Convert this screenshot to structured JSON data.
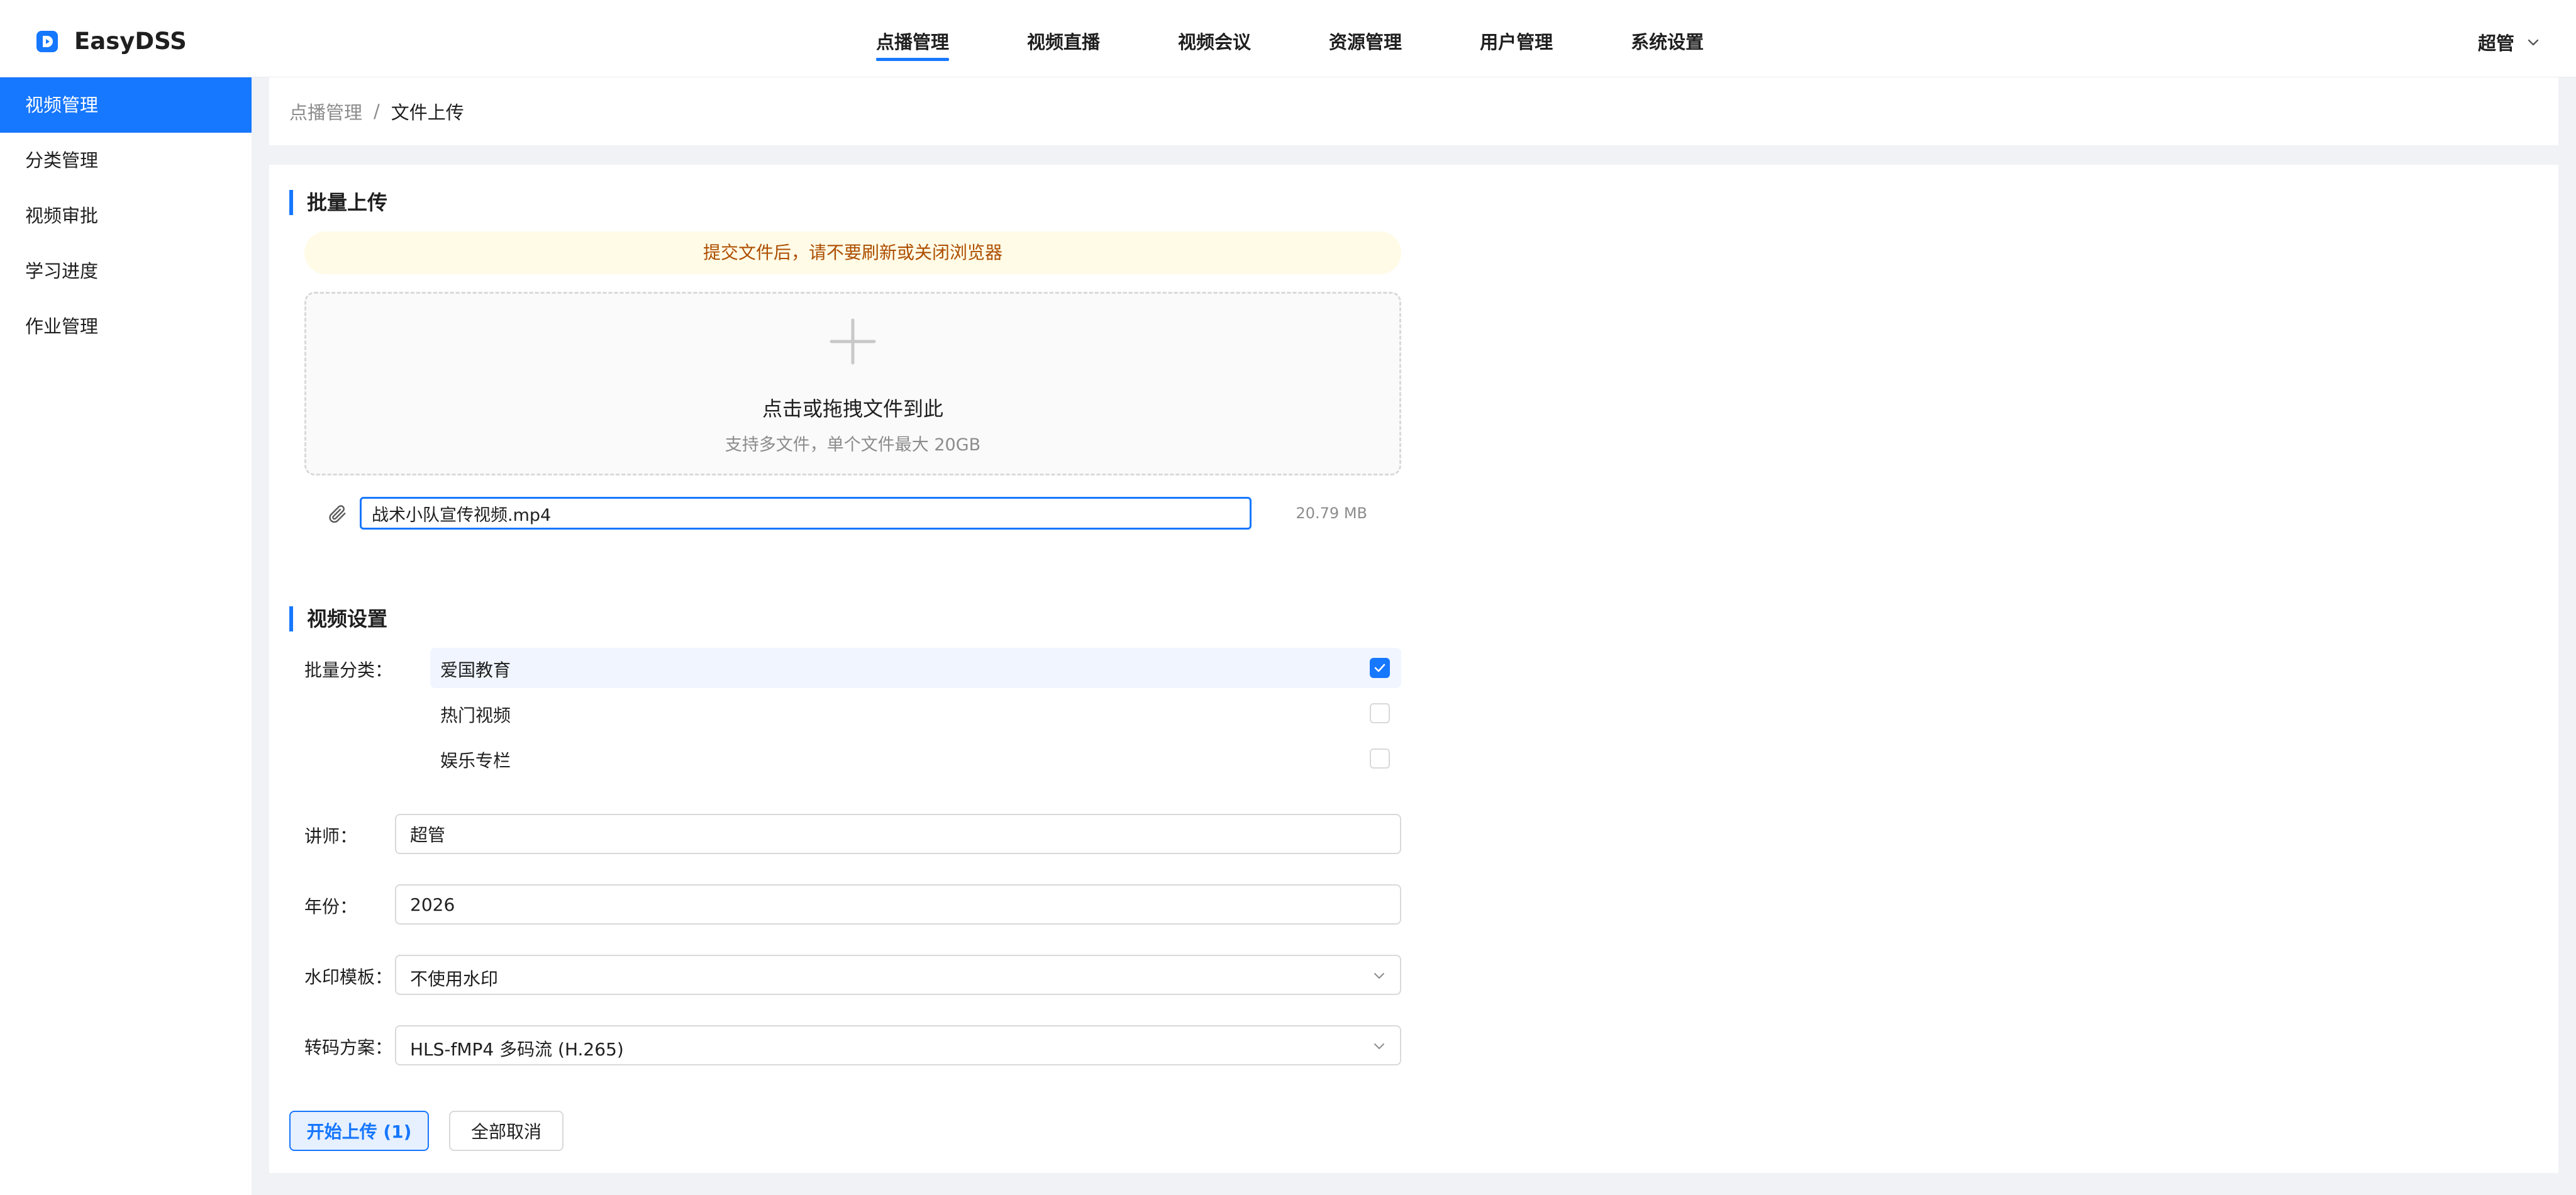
{
  "app": {
    "name": "EasyDSS"
  },
  "nav": [
    {
      "label": "点播管理",
      "active": true
    },
    {
      "label": "视频直播"
    },
    {
      "label": "视频会议"
    },
    {
      "label": "资源管理"
    },
    {
      "label": "用户管理"
    },
    {
      "label": "系统设置"
    }
  ],
  "user": {
    "name": "超管"
  },
  "sidebar": {
    "items": [
      {
        "label": "视频管理",
        "active": true
      },
      {
        "label": "分类管理"
      },
      {
        "label": "视频审批"
      },
      {
        "label": "学习进度"
      },
      {
        "label": "作业管理"
      }
    ]
  },
  "breadcrumb": {
    "parent": "点播管理",
    "separator": "/",
    "current": "文件上传"
  },
  "upload": {
    "title": "批量上传",
    "notice": "提交文件后，请不要刷新或关闭浏览器",
    "dropzone_title": "点击或拖拽文件到此",
    "dropzone_hint": "支持多文件，单个文件最大 20GB",
    "file": {
      "name": "战术小队宣传视频.mp4",
      "size": "20.79 MB"
    }
  },
  "settings": {
    "title": "视频设置",
    "category_label": "批量分类：",
    "categories": [
      {
        "label": "爱国教育",
        "checked": true
      },
      {
        "label": "热门视频",
        "checked": false
      },
      {
        "label": "娱乐专栏",
        "checked": false
      }
    ],
    "teacher_label": "讲师：",
    "teacher_value": "超管",
    "year_label": "年份：",
    "year_value": "2026",
    "watermark_label": "水印模板：",
    "watermark_value": "不使用水印",
    "transcode_label": "转码方案：",
    "transcode_value": "HLS-fMP4 多码流 (H.265)"
  },
  "actions": {
    "start_label": "开始上传 (1)",
    "cancel_label": "全部取消"
  },
  "colors": {
    "accent": "#1677ff",
    "notice_bg": "#fffbe6",
    "notice_text": "#ad4e00"
  }
}
